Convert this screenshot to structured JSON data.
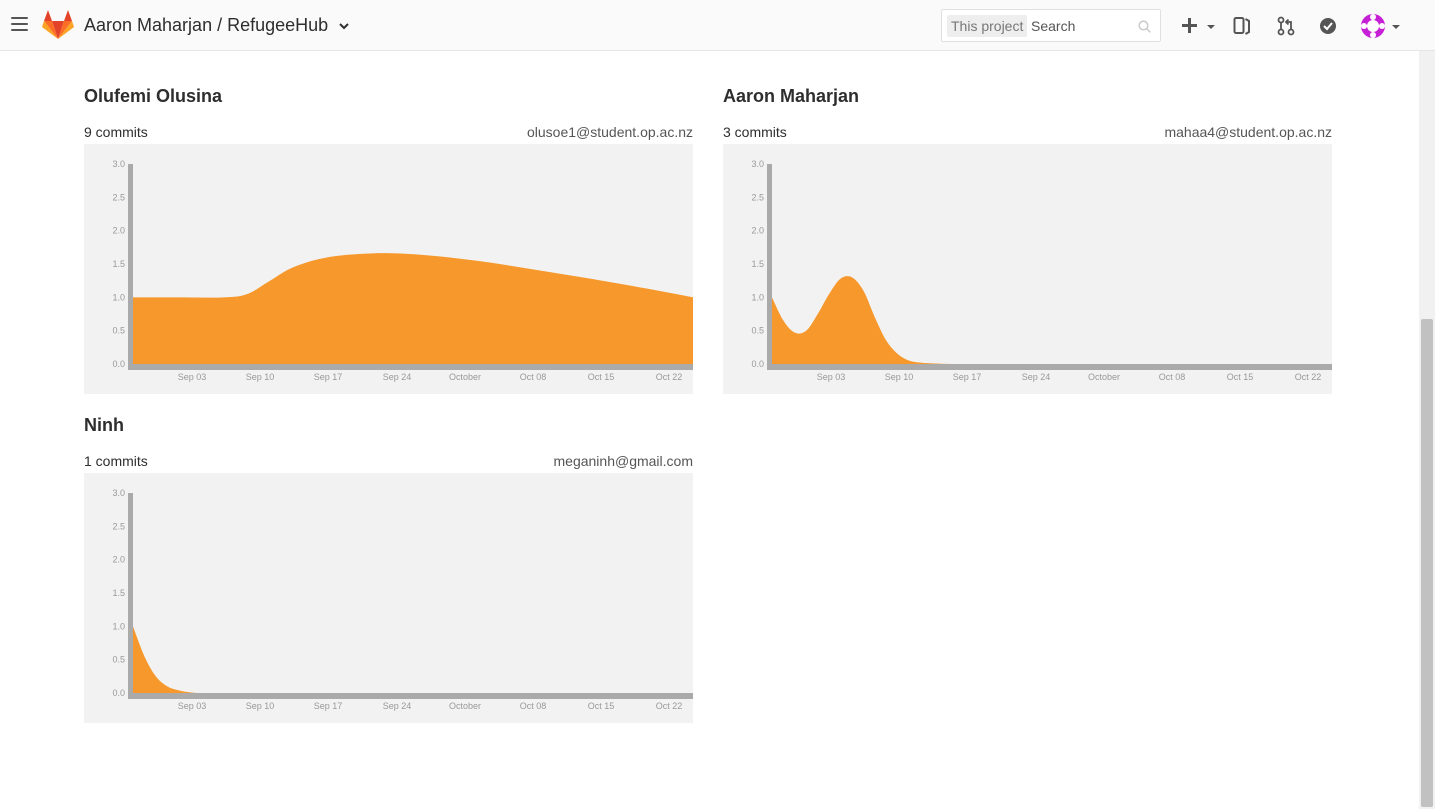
{
  "header": {
    "breadcrumb": "Aaron Maharjan / RefugeeHub",
    "search": {
      "scope_label": "This project",
      "placeholder": "Search"
    },
    "icons": [
      "menu-icon",
      "gitlab-logo",
      "chevron-down-icon",
      "search-icon",
      "plus-icon",
      "issues-icon",
      "merge-request-icon",
      "todo-check-icon",
      "avatar"
    ]
  },
  "colors": {
    "accent": "#f6982c",
    "axis": "#aaaaaa",
    "chart_bg": "#f2f2f2",
    "avatar": "#c620d7"
  },
  "contributors": [
    {
      "name": "Olufemi Olusina",
      "commits_text": "9 commits",
      "email": "olusoe1@student.op.ac.nz"
    },
    {
      "name": "Aaron Maharjan",
      "commits_text": "3 commits",
      "email": "mahaa4@student.op.ac.nz"
    },
    {
      "name": "Ninh",
      "commits_text": "1 commits",
      "email": "meganinh@gmail.com"
    }
  ],
  "chart_data": [
    {
      "type": "area",
      "ylim": [
        0,
        3.0
      ],
      "yticks": [
        "3.0",
        "2.5",
        "2.0",
        "1.5",
        "1.0",
        "0.5",
        "0.0"
      ],
      "xticks": [
        "Sep 03",
        "Sep 10",
        "Sep 17",
        "Sep 24",
        "October",
        "Oct 08",
        "Oct 15",
        "Oct 22"
      ],
      "x": [
        0,
        4,
        8,
        10,
        12,
        14,
        17,
        21,
        25,
        30,
        35,
        40,
        45,
        49
      ],
      "y": [
        1.0,
        1.0,
        1.0,
        1.05,
        1.25,
        1.45,
        1.6,
        1.66,
        1.64,
        1.55,
        1.42,
        1.28,
        1.13,
        1.0
      ],
      "x_note": "days after first date on axis"
    },
    {
      "type": "area",
      "ylim": [
        0,
        3.0
      ],
      "yticks": [
        "3.0",
        "2.5",
        "2.0",
        "1.5",
        "1.0",
        "0.5",
        "0.0"
      ],
      "xticks": [
        "Sep 03",
        "Sep 10",
        "Sep 17",
        "Sep 24",
        "October",
        "Oct 08",
        "Oct 15",
        "Oct 22"
      ],
      "x": [
        0,
        1,
        2,
        3,
        4,
        5,
        6,
        7,
        8,
        9,
        10,
        11,
        12,
        13,
        14,
        16,
        20,
        30,
        40,
        49
      ],
      "y": [
        1.0,
        0.65,
        0.47,
        0.5,
        0.75,
        1.05,
        1.28,
        1.3,
        1.1,
        0.7,
        0.35,
        0.15,
        0.05,
        0.02,
        0.01,
        0,
        0,
        0,
        0,
        0
      ]
    },
    {
      "type": "area",
      "ylim": [
        0,
        3.0
      ],
      "yticks": [
        "3.0",
        "2.5",
        "2.0",
        "1.5",
        "1.0",
        "0.5",
        "0.0"
      ],
      "xticks": [
        "Sep 03",
        "Sep 10",
        "Sep 17",
        "Sep 24",
        "October",
        "Oct 08",
        "Oct 15",
        "Oct 22"
      ],
      "x": [
        0,
        1,
        2,
        3,
        4,
        5,
        6,
        8,
        10,
        20,
        30,
        40,
        49
      ],
      "y": [
        1.0,
        0.55,
        0.25,
        0.1,
        0.04,
        0.01,
        0,
        0,
        0,
        0,
        0,
        0,
        0
      ]
    }
  ]
}
